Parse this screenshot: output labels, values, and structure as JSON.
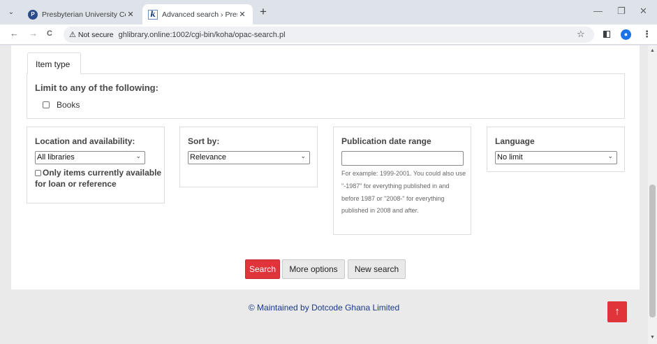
{
  "browser": {
    "tabs": [
      {
        "title": "Presbyterian University College",
        "active": false
      },
      {
        "title": "Advanced search › Presbyterian",
        "active": true
      }
    ],
    "security_label": "Not secure",
    "url": "ghlibrary.online:1002/cgi-bin/koha/opac-search.pl",
    "icons": {
      "back": "←",
      "forward": "→",
      "reload": "C",
      "star": "☆",
      "new_tab": "+",
      "close": "✕",
      "minimize": "—",
      "restore": "❐"
    }
  },
  "page": {
    "item_type_tab": "Item type",
    "limit_title": "Limit to any of the following:",
    "item_types": [
      "Books"
    ],
    "location": {
      "heading": "Location and availability:",
      "selected": "All libraries",
      "checkbox_label": "Only items currently available for loan or reference"
    },
    "sort": {
      "heading": "Sort by:",
      "selected": "Relevance"
    },
    "pubdate": {
      "heading": "Publication date range",
      "value": "",
      "hint": "For example: 1999-2001. You could also use \"-1987\" for everything published in and before 1987 or \"2008-\" for everything published in 2008 and after."
    },
    "language": {
      "heading": "Language",
      "selected": "No limit"
    },
    "buttons": {
      "search": "Search",
      "more_options": "More options",
      "new_search": "New search"
    },
    "footer": "© Maintained by Dotcode Ghana Limited",
    "to_top_icon": "↑"
  },
  "colors": {
    "accent_red": "#e0343b",
    "footer_link": "#17398a",
    "page_bg": "#eaeaea"
  }
}
